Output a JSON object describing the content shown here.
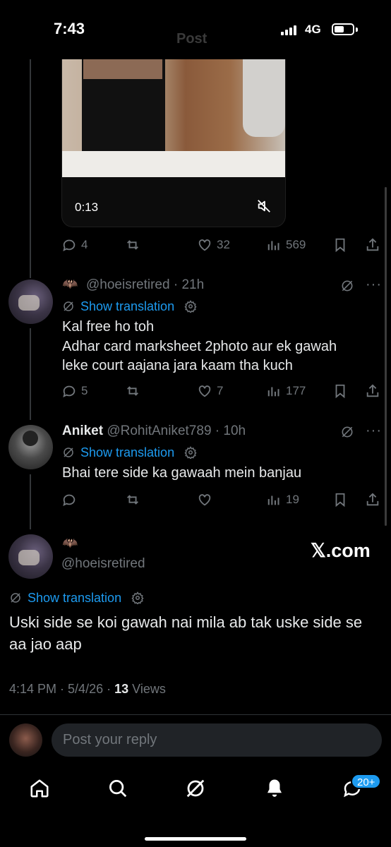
{
  "status_bar": {
    "time": "7:43",
    "title": "Post",
    "network": "4G"
  },
  "video": {
    "timestamp": "0:13",
    "mute_icon": "speaker-muted-icon"
  },
  "original_post_actions": {
    "replies": "4",
    "reposts": "",
    "likes": "32",
    "views": "569"
  },
  "reply1": {
    "emoji": "🦇",
    "handle": "@hoeisretired",
    "time": "21h",
    "show_translation": "Show translation",
    "text_lines": [
      "Kal free ho toh",
      "Adhar card marksheet 2photo aur ek gawah",
      "leke court aajana jara kaam tha kuch"
    ],
    "actions": {
      "replies": "5",
      "reposts": "",
      "likes": "7",
      "views": "177"
    }
  },
  "reply2": {
    "name": "Aniket",
    "handle": "@RohitAniket789",
    "time": "10h",
    "show_translation": "Show translation",
    "text": "Bhai tere side ka gawaah mein banjau",
    "actions": {
      "replies": "",
      "reposts": "",
      "likes": "",
      "views": "19"
    }
  },
  "main_post": {
    "emoji": "🦇",
    "handle": "@hoeisretired",
    "watermark": "𝕏.com",
    "show_translation": "Show translation",
    "text": "Uski side se koi gawah nai mila ab tak uske side se aa jao aap",
    "time": "4:14 PM",
    "date": "5/4/26",
    "views_count": "13",
    "views_label": "Views"
  },
  "reply_box": {
    "placeholder": "Post your reply"
  },
  "bottom_nav": {
    "items": [
      "home-icon",
      "search-icon",
      "grok-icon",
      "notifications-icon",
      "messages-icon"
    ],
    "badge": "20+"
  },
  "colors": {
    "accent": "#1d9bf0",
    "muted": "#71767b",
    "text": "#e7e9ea",
    "background": "#000000"
  }
}
